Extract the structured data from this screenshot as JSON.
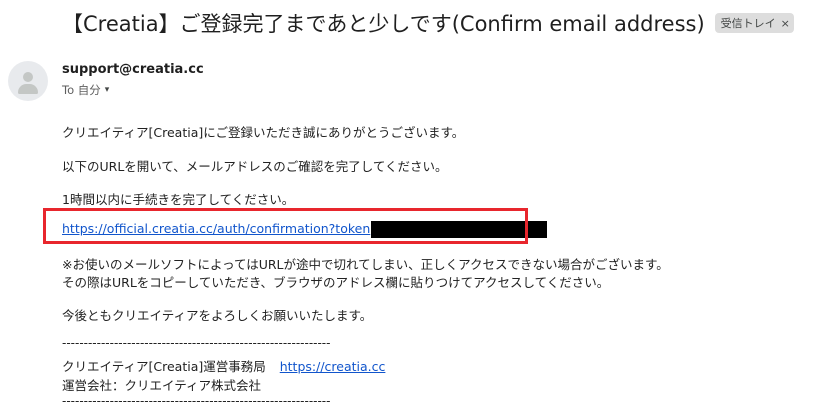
{
  "header": {
    "subject": "【Creatia】ご登録完了まであと少しです(Confirm email address)",
    "label": "受信トレイ",
    "label_close": "×"
  },
  "sender": {
    "email": "support@creatia.cc",
    "to": "To 自分",
    "caret": "▾",
    "avatar_icon": "person-icon"
  },
  "body": {
    "line1": "クリエイティア[Creatia]にご登録いただき誠にありがとうございます。",
    "line2": "以下のURLを開いて、メールアドレスのご確認を完了してください。",
    "line3": "1時間以内に手続きを完了してください。",
    "link": "https://official.creatia.cc/auth/confirmation?token",
    "note1": "※お使いのメールソフトによってはURLが途中で切れてしまい、正しくアクセスできない場合がございます。",
    "note2": "その際はURLをコピーしていただき、ブラウザのアドレス欄に貼りつけてアクセスしてください。",
    "closing": "今後ともクリエイティアをよろしくお願いいたします。"
  },
  "footer": {
    "divider": "--------------------------------------------------------------",
    "office": "クリエイティア[Creatia]運営事務局",
    "site_link": "https://creatia.cc",
    "company": "運営会社：クリエイティア株式会社"
  },
  "colors": {
    "link": "#1155cc",
    "highlight": "#e8262d",
    "redaction": "#000000",
    "chip_bg": "#dddddd"
  }
}
